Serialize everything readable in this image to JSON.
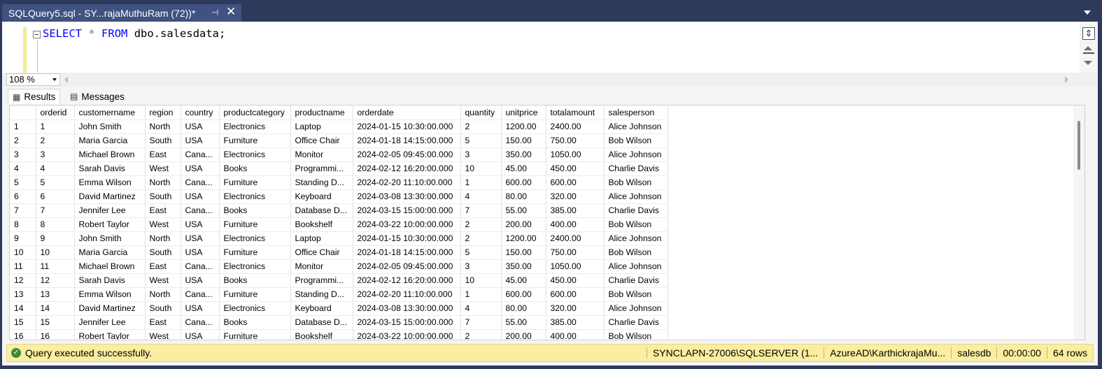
{
  "tab": {
    "title": "SQLQuery5.sql - SY...rajaMuthuRam (72))*",
    "pin": "⊣",
    "close": "✕"
  },
  "editor": {
    "keyword1": "SELECT",
    "star": "*",
    "keyword2": "FROM",
    "rest": "dbo.salesdata;"
  },
  "zoom": {
    "value": "108 %"
  },
  "results_tabs": {
    "results": "Results",
    "messages": "Messages"
  },
  "grid": {
    "columns": [
      "",
      "orderid",
      "customername",
      "region",
      "country",
      "productcategory",
      "productname",
      "orderdate",
      "quantity",
      "unitprice",
      "totalamount",
      "salesperson"
    ],
    "rows": [
      [
        "1",
        "1",
        "John Smith",
        "North",
        "USA",
        "Electronics",
        "Laptop",
        "2024-01-15 10:30:00.000",
        "2",
        "1200.00",
        "2400.00",
        "Alice Johnson"
      ],
      [
        "2",
        "2",
        "Maria Garcia",
        "South",
        "USA",
        "Furniture",
        "Office Chair",
        "2024-01-18 14:15:00.000",
        "5",
        "150.00",
        "750.00",
        "Bob Wilson"
      ],
      [
        "3",
        "3",
        "Michael Brown",
        "East",
        "Cana...",
        "Electronics",
        "Monitor",
        "2024-02-05 09:45:00.000",
        "3",
        "350.00",
        "1050.00",
        "Alice Johnson"
      ],
      [
        "4",
        "4",
        "Sarah Davis",
        "West",
        "USA",
        "Books",
        "Programmi...",
        "2024-02-12 16:20:00.000",
        "10",
        "45.00",
        "450.00",
        "Charlie Davis"
      ],
      [
        "5",
        "5",
        "Emma Wilson",
        "North",
        "Cana...",
        "Furniture",
        "Standing D...",
        "2024-02-20 11:10:00.000",
        "1",
        "600.00",
        "600.00",
        "Bob Wilson"
      ],
      [
        "6",
        "6",
        "David Martinez",
        "South",
        "USA",
        "Electronics",
        "Keyboard",
        "2024-03-08 13:30:00.000",
        "4",
        "80.00",
        "320.00",
        "Alice Johnson"
      ],
      [
        "7",
        "7",
        "Jennifer Lee",
        "East",
        "Cana...",
        "Books",
        "Database D...",
        "2024-03-15 15:00:00.000",
        "7",
        "55.00",
        "385.00",
        "Charlie Davis"
      ],
      [
        "8",
        "8",
        "Robert Taylor",
        "West",
        "USA",
        "Furniture",
        "Bookshelf",
        "2024-03-22 10:00:00.000",
        "2",
        "200.00",
        "400.00",
        "Bob Wilson"
      ],
      [
        "9",
        "9",
        "John Smith",
        "North",
        "USA",
        "Electronics",
        "Laptop",
        "2024-01-15 10:30:00.000",
        "2",
        "1200.00",
        "2400.00",
        "Alice Johnson"
      ],
      [
        "10",
        "10",
        "Maria Garcia",
        "South",
        "USA",
        "Furniture",
        "Office Chair",
        "2024-01-18 14:15:00.000",
        "5",
        "150.00",
        "750.00",
        "Bob Wilson"
      ],
      [
        "11",
        "11",
        "Michael Brown",
        "East",
        "Cana...",
        "Electronics",
        "Monitor",
        "2024-02-05 09:45:00.000",
        "3",
        "350.00",
        "1050.00",
        "Alice Johnson"
      ],
      [
        "12",
        "12",
        "Sarah Davis",
        "West",
        "USA",
        "Books",
        "Programmi...",
        "2024-02-12 16:20:00.000",
        "10",
        "45.00",
        "450.00",
        "Charlie Davis"
      ],
      [
        "13",
        "13",
        "Emma Wilson",
        "North",
        "Cana...",
        "Furniture",
        "Standing D...",
        "2024-02-20 11:10:00.000",
        "1",
        "600.00",
        "600.00",
        "Bob Wilson"
      ],
      [
        "14",
        "14",
        "David Martinez",
        "South",
        "USA",
        "Electronics",
        "Keyboard",
        "2024-03-08 13:30:00.000",
        "4",
        "80.00",
        "320.00",
        "Alice Johnson"
      ],
      [
        "15",
        "15",
        "Jennifer Lee",
        "East",
        "Cana...",
        "Books",
        "Database D...",
        "2024-03-15 15:00:00.000",
        "7",
        "55.00",
        "385.00",
        "Charlie Davis"
      ],
      [
        "16",
        "16",
        "Robert Taylor",
        "West",
        "USA",
        "Furniture",
        "Bookshelf",
        "2024-03-22 10:00:00.000",
        "2",
        "200.00",
        "400.00",
        "Bob Wilson"
      ]
    ]
  },
  "status": {
    "message": "Query executed successfully.",
    "server": "SYNCLAPN-27006\\SQLSERVER (1...",
    "user": "AzureAD\\KarthickrajaMu...",
    "database": "salesdb",
    "elapsed": "00:00:00",
    "rows": "64 rows"
  },
  "colors": {
    "accent": "#3f5280",
    "status_bg": "#fbeea0",
    "keyword": "#0000ff"
  }
}
